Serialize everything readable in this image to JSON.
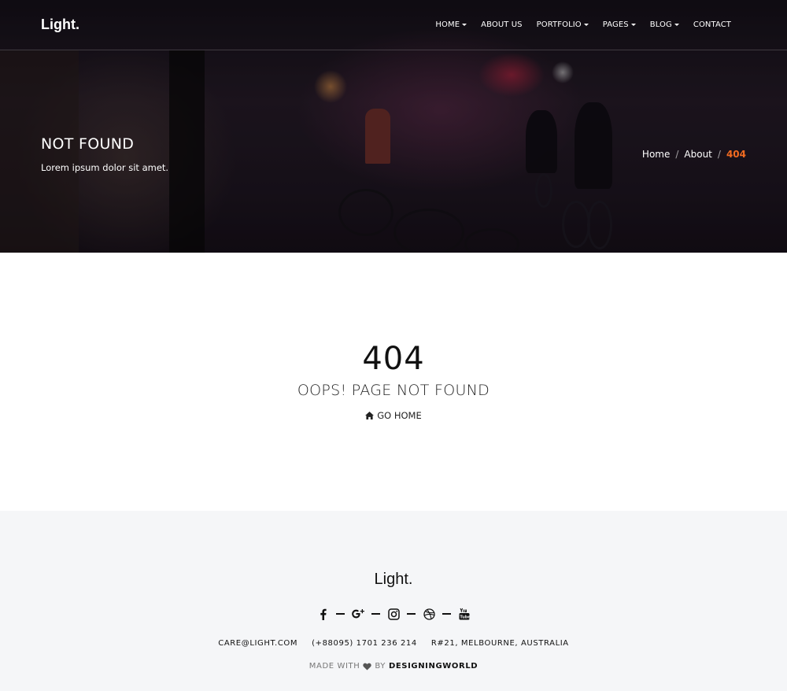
{
  "header": {
    "brand": "Light.",
    "nav": [
      {
        "label": "HOME",
        "dropdown": true
      },
      {
        "label": "ABOUT US",
        "dropdown": false
      },
      {
        "label": "PORTFOLIO",
        "dropdown": true
      },
      {
        "label": "PAGES",
        "dropdown": true
      },
      {
        "label": "BLOG",
        "dropdown": true
      },
      {
        "label": "CONTACT",
        "dropdown": false
      }
    ]
  },
  "hero": {
    "title": "NOT FOUND",
    "subtitle": "Lorem ipsum dolor sit amet.",
    "breadcrumb": [
      "Home",
      "About",
      "404"
    ],
    "separator": "/",
    "active_color": "#f26b21"
  },
  "main": {
    "code": "404",
    "message": "OOPS! PAGE NOT FOUND",
    "home_link": "GO HOME",
    "home_icon": "home-icon"
  },
  "footer": {
    "brand": "Light.",
    "socials": [
      "facebook-icon",
      "google-plus-icon",
      "instagram-icon",
      "dribbble-icon",
      "youtube-icon"
    ],
    "email": "CARE@LIGHT.COM",
    "phone": "(+88095) 1701 236 214",
    "address": "R#21, MELBOURNE, AUSTRALIA",
    "made_with": "MADE WITH",
    "by": "BY",
    "author": "DESIGNINGWORLD"
  }
}
